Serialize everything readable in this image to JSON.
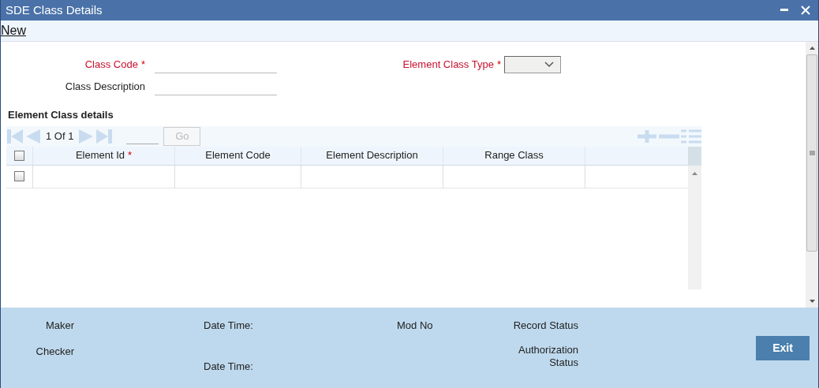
{
  "window": {
    "title": "SDE Class Details"
  },
  "toolbar": {
    "link": "New"
  },
  "required_mark": "*",
  "fields": [
    {
      "label": "Class Code",
      "required": true,
      "kind": "text"
    },
    {
      "label": "Class Description",
      "required": false,
      "kind": "text"
    },
    {
      "label": "Element Class Type",
      "required": true,
      "kind": "select"
    }
  ],
  "grid": {
    "title": "Element Class details",
    "pager": "1 Of 1",
    "go": "Go",
    "columns": [
      {
        "label": "Element Id",
        "required": true
      },
      {
        "label": "Element Code",
        "required": false
      },
      {
        "label": "Element Description",
        "required": false
      },
      {
        "label": "Range Class",
        "required": false
      }
    ],
    "rows": [
      {
        "checked": false
      }
    ],
    "header_checked": false
  },
  "footer": {
    "labels": [
      {
        "text": "Maker"
      },
      {
        "text": "Date Time:"
      },
      {
        "text": "Mod No"
      },
      {
        "text": "Record Status"
      },
      {
        "text": "Checker"
      },
      {
        "text": "Date Time:"
      },
      {
        "text": "Authorization Status"
      }
    ],
    "button": "Exit"
  }
}
